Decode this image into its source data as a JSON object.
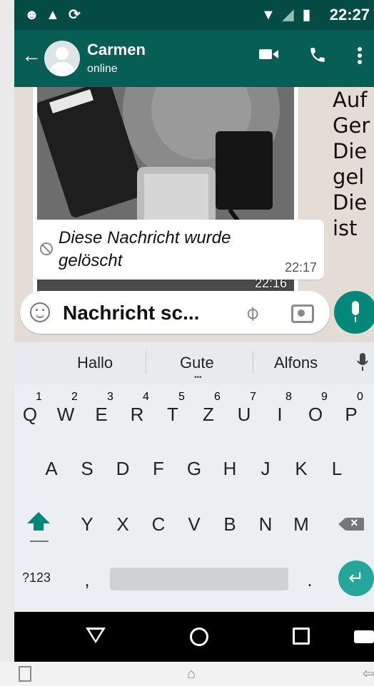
{
  "status_bar": {
    "time": "22:27",
    "icons": [
      "android-icon",
      "warning-icon",
      "sync-icon",
      "wifi-icon",
      "signal-icon",
      "battery-icon"
    ]
  },
  "chat_header": {
    "contact_name": "Carmen",
    "contact_status": "online",
    "actions": [
      "video-call-icon",
      "phone-icon",
      "more-icon"
    ]
  },
  "messages": [
    {
      "type": "image",
      "time": "22:16"
    },
    {
      "type": "deleted",
      "text": "Diese Nachricht wurde gelöscht",
      "time": "22:17"
    }
  ],
  "overflow_text": "Auf\nGer\nDie\ngel\nDie\nist ",
  "composer": {
    "placeholder": "Nachricht sc...",
    "value": ""
  },
  "keyboard": {
    "suggestions": [
      "Hallo",
      "Gute",
      "Alfons"
    ],
    "row1": [
      "Q",
      "W",
      "E",
      "R",
      "T",
      "Z",
      "U",
      "I",
      "O",
      "P"
    ],
    "row1_hints": [
      "1",
      "2",
      "3",
      "4",
      "5",
      "6",
      "7",
      "8",
      "9",
      "0"
    ],
    "row2": [
      "A",
      "S",
      "D",
      "F",
      "G",
      "H",
      "J",
      "K",
      "L"
    ],
    "row3": [
      "Y",
      "X",
      "C",
      "V",
      "B",
      "N",
      "M"
    ],
    "symbols_key": "?123",
    "comma_key": ",",
    "period_key": "."
  },
  "colors": {
    "header": "#075e54",
    "statusbar": "#054d44",
    "accent": "#00897b",
    "chat_bg": "#e5ddd5"
  }
}
